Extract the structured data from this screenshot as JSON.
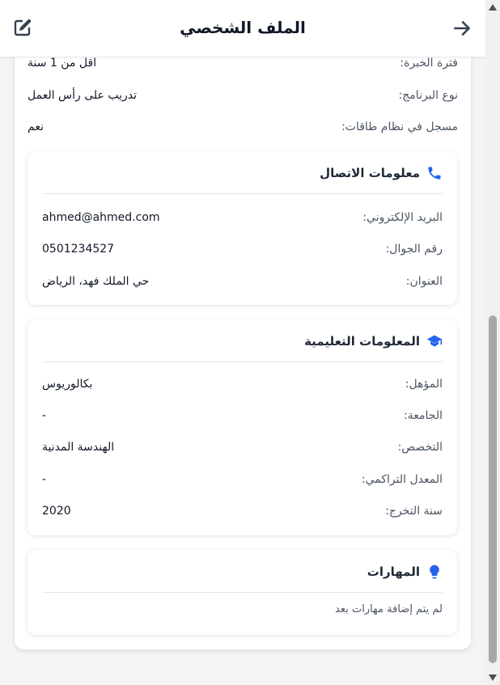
{
  "header": {
    "title": "الملف الشخصي",
    "back_icon": "arrow-right-icon",
    "edit_icon": "edit-icon"
  },
  "details": [
    {
      "label": "فترة الخبرة:",
      "value": "أقل من 1 سنة"
    },
    {
      "label": "نوع البرنامج:",
      "value": "تدريب على رأس العمل"
    },
    {
      "label": "مسجل في نظام طاقات:",
      "value": "نعم"
    }
  ],
  "contact": {
    "title": "معلومات الاتصال",
    "icon": "phone-icon",
    "rows": [
      {
        "label": "البريد الإلكتروني:",
        "value": "ahmed@ahmed.com"
      },
      {
        "label": "رقم الجوال:",
        "value": "0501234527"
      },
      {
        "label": "العنوان:",
        "value": "حي الملك فهد، الرياض"
      }
    ]
  },
  "education": {
    "title": "المعلومات التعليمية",
    "icon": "graduation-cap-icon",
    "rows": [
      {
        "label": "المؤهل:",
        "value": "بكالوريوس"
      },
      {
        "label": "الجامعة:",
        "value": "-"
      },
      {
        "label": "التخصص:",
        "value": "الهندسة المدنية"
      },
      {
        "label": "المعدل التراكمي:",
        "value": "-"
      },
      {
        "label": "سنة التخرج:",
        "value": "2020"
      }
    ]
  },
  "skills": {
    "title": "المهارات",
    "icon": "lightbulb-icon",
    "empty_text": "لم يتم إضافة مهارات بعد"
  },
  "colors": {
    "accent": "#2563eb",
    "text": "#111827",
    "muted": "#4b5563"
  }
}
